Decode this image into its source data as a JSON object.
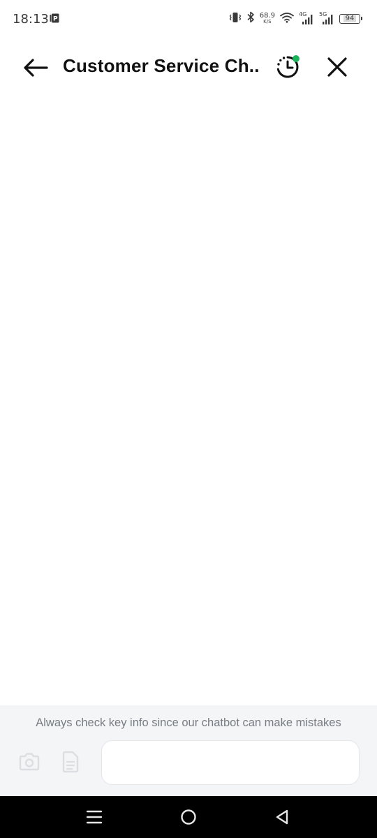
{
  "status_bar": {
    "time": "18:13",
    "net_speed": "68.9",
    "net_speed_unit": "K/S",
    "sim1_type": "4G",
    "sim2_type": "5G",
    "battery": "94",
    "icons": [
      "parking-notification-icon",
      "vibrate-icon",
      "bluetooth-icon",
      "wifi-icon",
      "signal-icon",
      "battery-icon"
    ]
  },
  "header": {
    "title": "Customer Service Ch...",
    "back_icon": "arrow-left-icon",
    "history_icon": "history-clock-icon",
    "history_badge_color": "#19b45a",
    "close_icon": "close-icon"
  },
  "composer": {
    "disclaimer": "Always check key info since our chatbot can make mistakes",
    "camera_icon": "camera-icon",
    "file_icon": "document-icon",
    "input_value": "",
    "input_placeholder": ""
  },
  "nav_bar": {
    "icons": [
      "menu-icon",
      "home-icon",
      "back-triangle-icon"
    ]
  },
  "colors": {
    "background": "#ffffff",
    "composer_background": "#f4f5f7",
    "badge": "#19b45a",
    "nav_background": "#000000"
  }
}
